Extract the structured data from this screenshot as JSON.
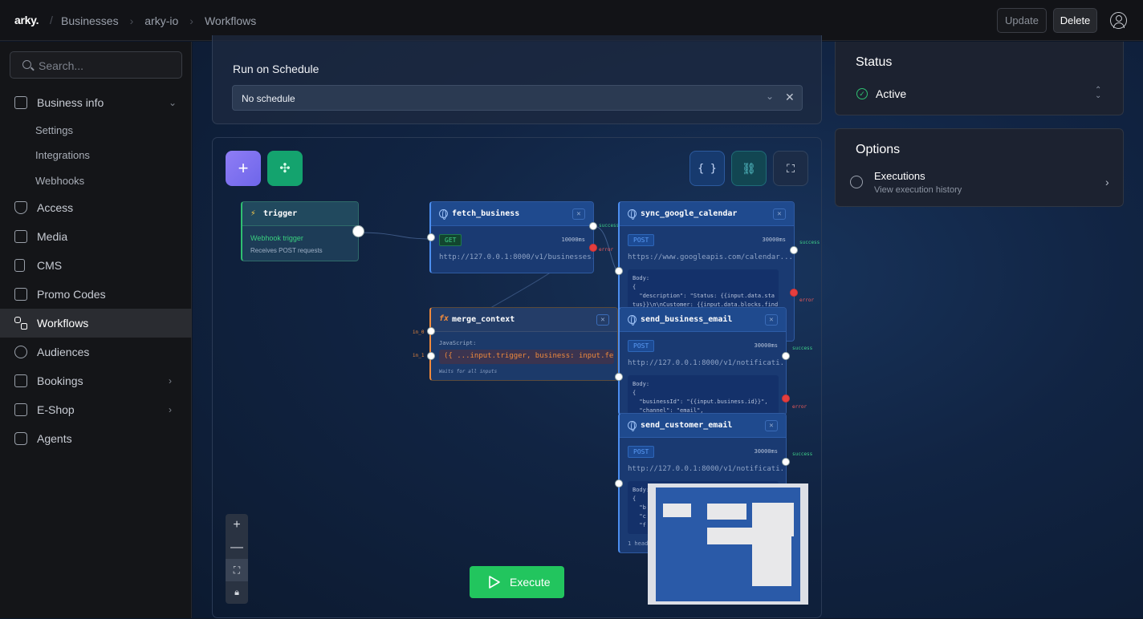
{
  "brand": {
    "logo": "arky."
  },
  "breadcrumb": [
    "Businesses",
    "arky-io",
    "Workflows"
  ],
  "header": {
    "update_label": "Update",
    "delete_label": "Delete"
  },
  "search": {
    "placeholder": "Search..."
  },
  "sidebar": {
    "items": [
      {
        "label": "Business info",
        "icon": "building-icon"
      },
      {
        "label": "Access",
        "icon": "shield-icon"
      },
      {
        "label": "Media",
        "icon": "image-icon"
      },
      {
        "label": "CMS",
        "icon": "document-icon"
      },
      {
        "label": "Promo Codes",
        "icon": "ticket-icon"
      },
      {
        "label": "Workflows",
        "icon": "workflow-icon"
      },
      {
        "label": "Audiences",
        "icon": "users-icon"
      },
      {
        "label": "Bookings",
        "icon": "calendar-icon"
      },
      {
        "label": "E-Shop",
        "icon": "shop-icon"
      },
      {
        "label": "Agents",
        "icon": "robot-icon"
      }
    ],
    "subitems": [
      "Settings",
      "Integrations",
      "Webhooks"
    ]
  },
  "schedule": {
    "label": "Run on Schedule",
    "value": "No schedule"
  },
  "status": {
    "title": "Status",
    "value": "Active"
  },
  "options": {
    "title": "Options",
    "executions_title": "Executions",
    "executions_sub": "View execution history"
  },
  "nodes": {
    "trigger": {
      "title": "trigger",
      "type": "Webhook trigger",
      "desc": "Receives POST requests"
    },
    "fetch_business": {
      "title": "fetch_business",
      "method": "GET",
      "timeout": "10000ms",
      "url": "http://127.0.0.1:8000/v1/businesses..."
    },
    "sync_google_calendar": {
      "title": "sync_google_calendar",
      "method": "POST",
      "timeout": "30000ms",
      "url": "https://www.googleapis.com/calendar...",
      "body": "Body:\n{\n  \"description\": \"Status: {{input.data.sta\ntus}}\\n\\nCustomer: {{input.data.blocks.find"
    },
    "merge_context": {
      "title": "merge_context",
      "js_label": "JavaScript:",
      "code": "({ ...input.trigger, business: input.fet...",
      "note": "Waits for all inputs",
      "in0": "in_0",
      "in1": "in_1"
    },
    "send_business_email": {
      "title": "send_business_email",
      "method": "POST",
      "timeout": "30000ms",
      "url": "http://127.0.0.1:8000/v1/notificati...",
      "body": "Body:\n{\n  \"businessId\": \"{{input.business.id}}\",\n  \"channel\": \"email\","
    },
    "send_customer_email": {
      "title": "send_customer_email",
      "method": "POST",
      "timeout": "30000ms",
      "url": "http://127.0.0.1:8000/v1/notificati...",
      "body": "Body:\n{\n  \"b\n  \"c\n  \"f",
      "footer": "1 heade"
    }
  },
  "ports": {
    "success": "success",
    "error": "error"
  },
  "execute": {
    "label": "Execute"
  }
}
